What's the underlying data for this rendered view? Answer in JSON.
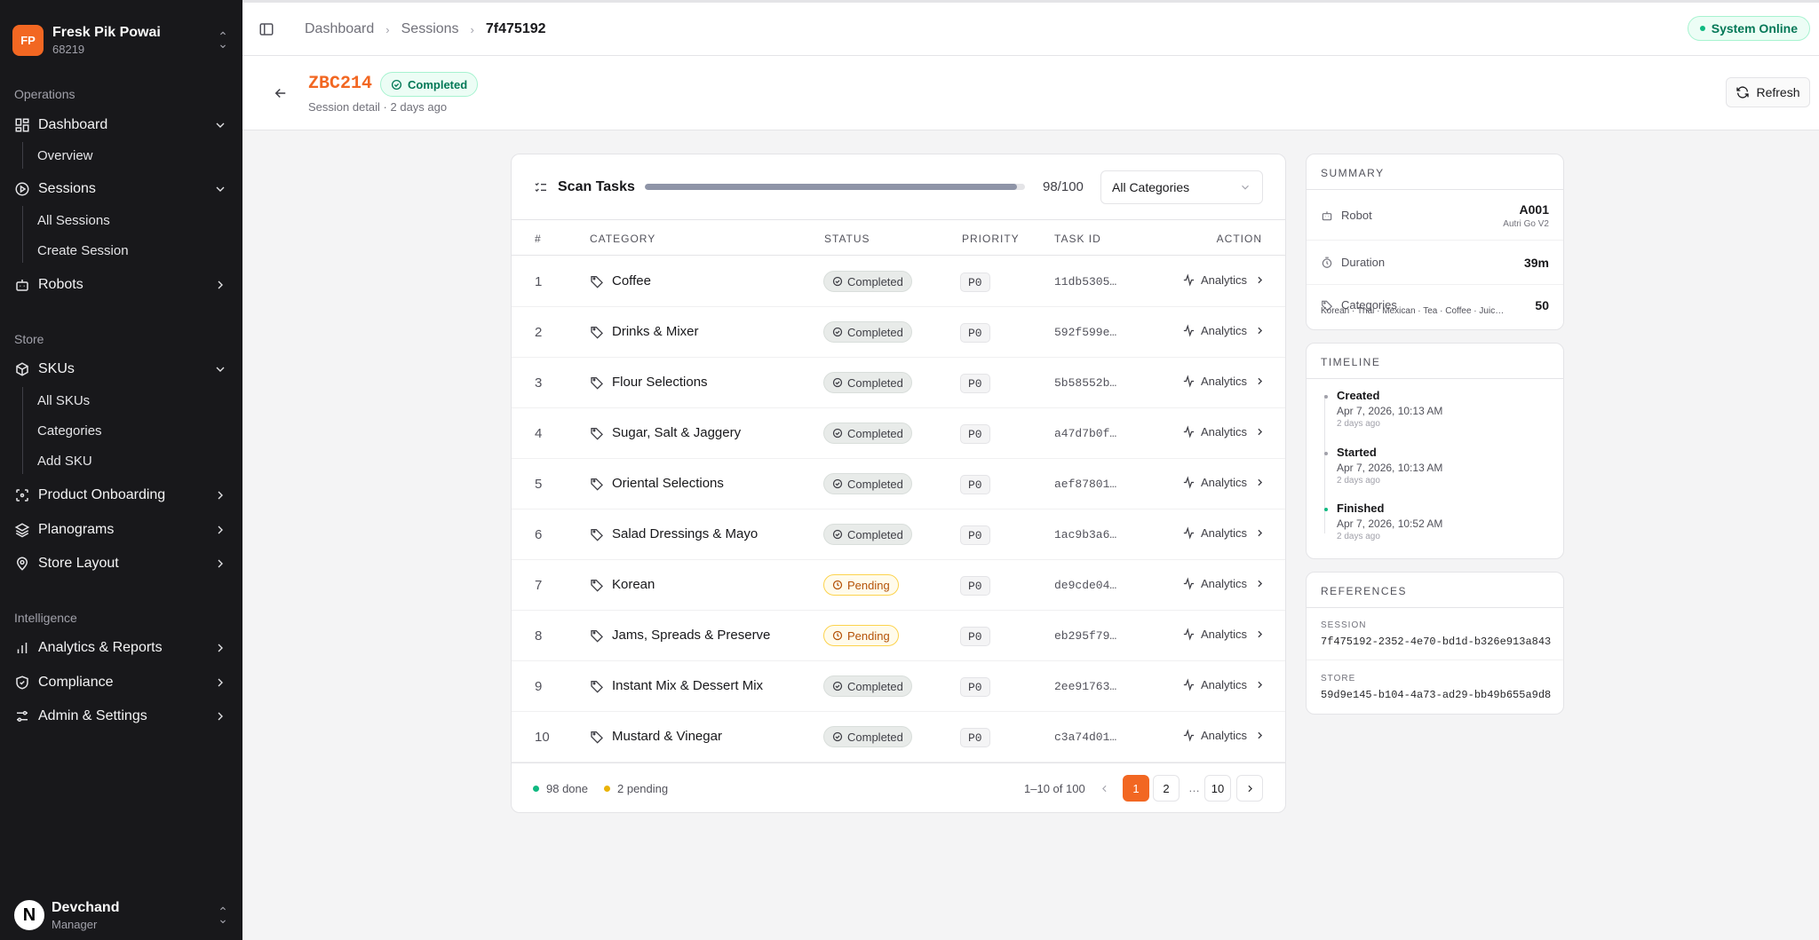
{
  "org": {
    "initials": "FP",
    "name": "Fresk Pik Powai",
    "id": "68219"
  },
  "sidebar": {
    "sections": [
      "Operations",
      "Store",
      "Intelligence"
    ],
    "items": [
      {
        "label": "Dashboard",
        "icon": "grid-icon"
      },
      {
        "label": "Sessions",
        "icon": "play-circle-icon"
      },
      {
        "label": "Robots",
        "icon": "robot-icon"
      },
      {
        "label": "SKUs",
        "icon": "box-icon"
      },
      {
        "label": "Product Onboarding",
        "icon": "scan-icon"
      },
      {
        "label": "Planograms",
        "icon": "layers-icon"
      },
      {
        "label": "Store Layout",
        "icon": "map-pin-icon"
      },
      {
        "label": "Analytics & Reports",
        "icon": "bar-chart-icon"
      },
      {
        "label": "Compliance",
        "icon": "shield-check-icon"
      },
      {
        "label": "Admin & Settings",
        "icon": "sliders-icon"
      }
    ],
    "dashboard_sub": [
      "Overview"
    ],
    "sessions_sub": [
      "All Sessions",
      "Create Session"
    ],
    "skus_sub": [
      "All SKUs",
      "Categories",
      "Add SKU"
    ]
  },
  "user": {
    "initial": "N",
    "name": "Devchand",
    "role": "Manager"
  },
  "breadcrumb": [
    "Dashboard",
    "Sessions",
    "7f475192"
  ],
  "system_status": "System Online",
  "session": {
    "code": "ZBC214",
    "status": "Completed",
    "detail": "Session detail · 2 days ago",
    "refresh_label": "Refresh"
  },
  "tasks": {
    "title": "Scan Tasks",
    "progress": {
      "done": 98,
      "total": 100,
      "label": "98/100"
    },
    "filter": "All Categories",
    "columns": [
      "#",
      "CATEGORY",
      "STATUS",
      "PRIORITY",
      "TASK ID",
      "ACTION"
    ],
    "rows": [
      {
        "n": "1",
        "category": "Coffee",
        "status": "Completed",
        "priority": "P0",
        "task_id": "11db5305…",
        "action": "Analytics"
      },
      {
        "n": "2",
        "category": "Drinks & Mixer",
        "status": "Completed",
        "priority": "P0",
        "task_id": "592f599e…",
        "action": "Analytics"
      },
      {
        "n": "3",
        "category": "Flour Selections",
        "status": "Completed",
        "priority": "P0",
        "task_id": "5b58552b…",
        "action": "Analytics"
      },
      {
        "n": "4",
        "category": "Sugar, Salt & Jaggery",
        "status": "Completed",
        "priority": "P0",
        "task_id": "a47d7b0f…",
        "action": "Analytics"
      },
      {
        "n": "5",
        "category": "Oriental Selections",
        "status": "Completed",
        "priority": "P0",
        "task_id": "aef87801…",
        "action": "Analytics"
      },
      {
        "n": "6",
        "category": "Salad Dressings & Mayo",
        "status": "Completed",
        "priority": "P0",
        "task_id": "1ac9b3a6…",
        "action": "Analytics"
      },
      {
        "n": "7",
        "category": "Korean",
        "status": "Pending",
        "priority": "P0",
        "task_id": "de9cde04…",
        "action": "Analytics"
      },
      {
        "n": "8",
        "category": "Jams, Spreads & Preserve",
        "status": "Pending",
        "priority": "P0",
        "task_id": "eb295f79…",
        "action": "Analytics"
      },
      {
        "n": "9",
        "category": "Instant Mix & Dessert Mix",
        "status": "Completed",
        "priority": "P0",
        "task_id": "2ee91763…",
        "action": "Analytics"
      },
      {
        "n": "10",
        "category": "Mustard & Vinegar",
        "status": "Completed",
        "priority": "P0",
        "task_id": "c3a74d01…",
        "action": "Analytics"
      }
    ],
    "footer": {
      "done_label": "98 done",
      "pending_label": "2 pending",
      "range": "1–10 of 100",
      "pages": [
        "1",
        "2",
        "…",
        "10"
      ]
    }
  },
  "summary": {
    "title": "SUMMARY",
    "robot_label": "Robot",
    "robot_id": "A001",
    "robot_model": "Autri Go V2",
    "duration_label": "Duration",
    "duration": "39m",
    "categories_label": "Categories",
    "categories_count": "50",
    "categories_list": "Korean · Thai · Mexican · Tea · Coffee · Juic…"
  },
  "timeline": {
    "title": "TIMELINE",
    "events": [
      {
        "title": "Created",
        "time": "Apr 7, 2026, 10:13 AM",
        "ago": "2 days ago"
      },
      {
        "title": "Started",
        "time": "Apr 7, 2026, 10:13 AM",
        "ago": "2 days ago"
      },
      {
        "title": "Finished",
        "time": "Apr 7, 2026, 10:52 AM",
        "ago": "2 days ago"
      }
    ]
  },
  "references": {
    "title": "REFERENCES",
    "session_label": "SESSION",
    "session_id": "7f475192-2352-4e70-bd1d-b326e913a843",
    "store_label": "STORE",
    "store_id": "59d9e145-b104-4a73-ad29-bb49b655a9d8"
  },
  "colors": {
    "accent": "#f26722",
    "success": "#10b981",
    "warning": "#eab308",
    "sidebar_bg": "#18181b"
  }
}
